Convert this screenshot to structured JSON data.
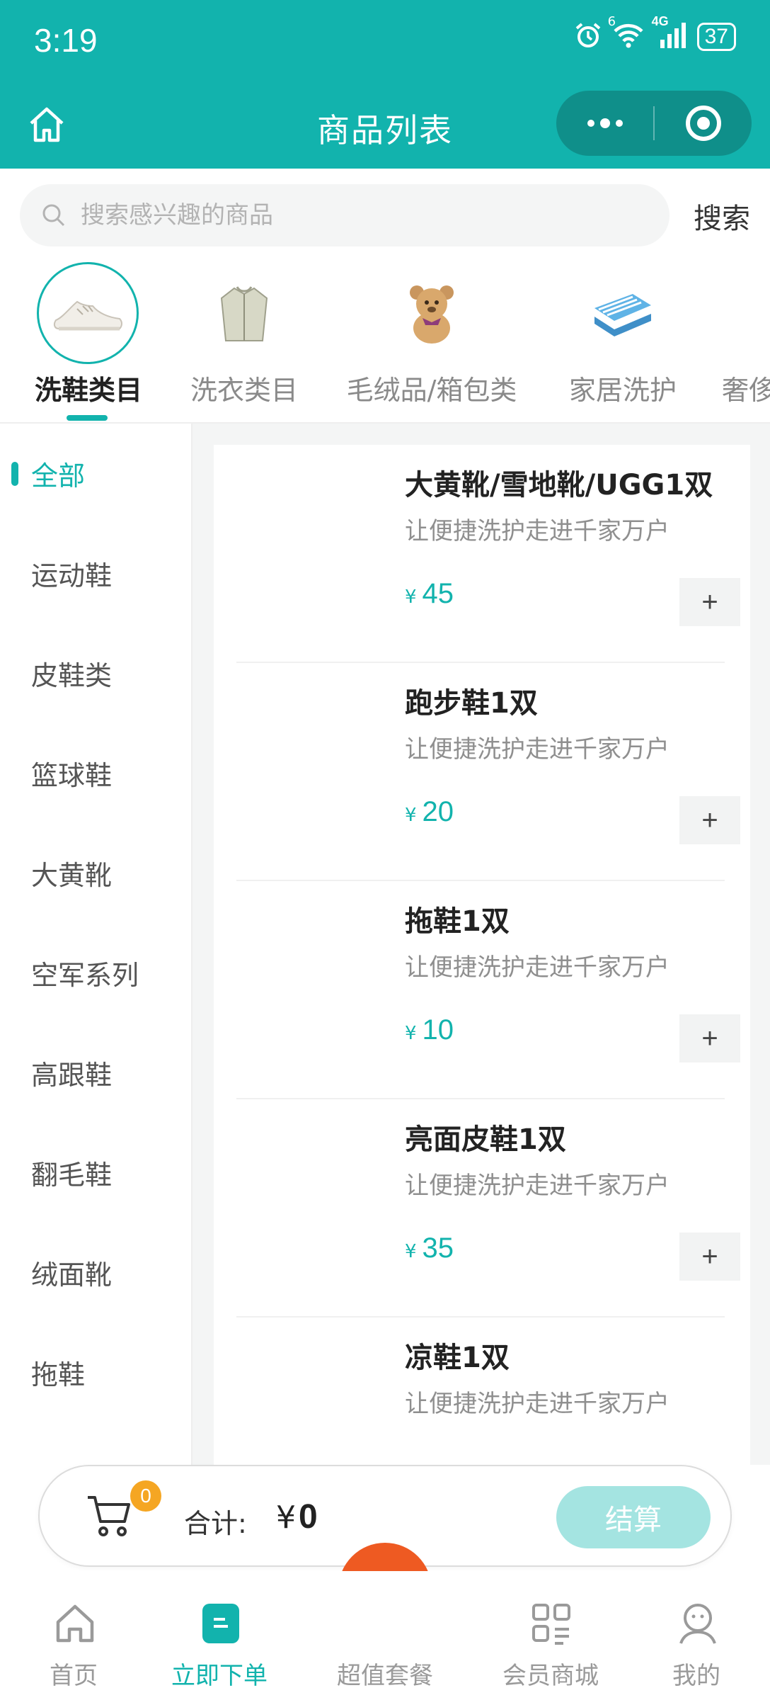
{
  "status_bar": {
    "time": "3:19",
    "network": "4G",
    "wifi_badge": "6",
    "battery": "37"
  },
  "nav": {
    "title": "商品列表"
  },
  "search": {
    "placeholder": "搜索感兴趣的商品",
    "value": "",
    "button_label": "搜索"
  },
  "categories": [
    {
      "label": "洗鞋类目",
      "icon": "sneaker-image",
      "active": true
    },
    {
      "label": "洗衣类目",
      "icon": "jacket-image",
      "active": false
    },
    {
      "label": "毛绒品/箱包类",
      "icon": "teddy-bear-image",
      "active": false
    },
    {
      "label": "家居洗护",
      "icon": "blanket-image",
      "active": false
    },
    {
      "label": "奢侈",
      "icon": "luxury-image",
      "active": false
    }
  ],
  "sidebar": {
    "items": [
      {
        "label": "全部",
        "active": true
      },
      {
        "label": "运动鞋",
        "active": false
      },
      {
        "label": "皮鞋类",
        "active": false
      },
      {
        "label": "篮球鞋",
        "active": false
      },
      {
        "label": "大黄靴",
        "active": false
      },
      {
        "label": "空军系列",
        "active": false
      },
      {
        "label": "高跟鞋",
        "active": false
      },
      {
        "label": "翻毛鞋",
        "active": false
      },
      {
        "label": "绒面靴",
        "active": false
      },
      {
        "label": "拖鞋",
        "active": false
      }
    ]
  },
  "products": [
    {
      "name": "大黄靴/雪地靴/UGG1双",
      "desc": "让便捷洗护走进千家万户",
      "currency": "¥",
      "price": "45",
      "add_label": "+"
    },
    {
      "name": "跑步鞋1双",
      "desc": "让便捷洗护走进千家万户",
      "currency": "¥",
      "price": "20",
      "add_label": "+"
    },
    {
      "name": "拖鞋1双",
      "desc": "让便捷洗护走进千家万户",
      "currency": "¥",
      "price": "10",
      "add_label": "+"
    },
    {
      "name": "亮面皮鞋1双",
      "desc": "让便捷洗护走进千家万户",
      "currency": "¥",
      "price": "35",
      "add_label": "+"
    },
    {
      "name": "凉鞋1双",
      "desc": "让便捷洗护走进千家万户",
      "currency": "",
      "price": "",
      "add_label": ""
    }
  ],
  "cart": {
    "count": "0",
    "total_label": "合计:",
    "currency": "¥",
    "total": "0",
    "checkout_label": "结算"
  },
  "tab_bar": [
    {
      "label": "首页",
      "icon": "home-icon",
      "active": false
    },
    {
      "label": "立即下单",
      "icon": "order-icon",
      "active": true
    },
    {
      "label": "超值套餐",
      "icon": "package-icon",
      "active": false
    },
    {
      "label": "会员商城",
      "icon": "grid-icon",
      "active": false
    },
    {
      "label": "我的",
      "icon": "profile-icon",
      "active": false
    }
  ],
  "colors": {
    "accent": "#12b3ad",
    "checkout_disabled": "#a4e4e1",
    "badge": "#f5a623",
    "fab": "#ee5a22"
  }
}
